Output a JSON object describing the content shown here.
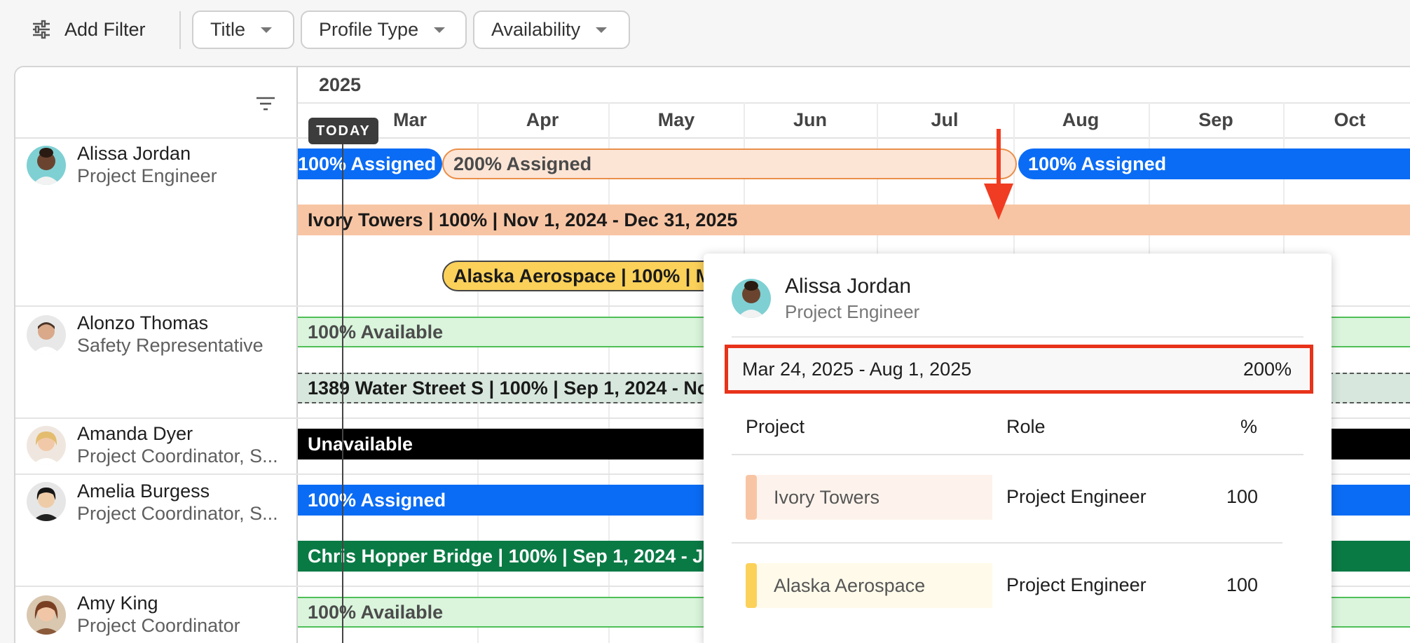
{
  "filters": {
    "add_filter_label": "Add Filter",
    "chips": [
      {
        "label": "Title"
      },
      {
        "label": "Profile Type"
      },
      {
        "label": "Availability"
      }
    ]
  },
  "timeline": {
    "year": "2025",
    "months": [
      "Mar",
      "Apr",
      "May",
      "Jun",
      "Jul",
      "Aug",
      "Sep",
      "Oct"
    ],
    "today_label": "TODAY"
  },
  "people": [
    {
      "name": "Alissa Jordan",
      "title": "Project Engineer"
    },
    {
      "name": "Alonzo Thomas",
      "title": "Safety Representative"
    },
    {
      "name": "Amanda Dyer",
      "title": "Project Coordinator, S..."
    },
    {
      "name": "Amelia Burgess",
      "title": "Project Coordinator, S..."
    },
    {
      "name": "Amy King",
      "title": "Project Coordinator"
    }
  ],
  "bars": {
    "alissa_assigned_1": "100% Assigned",
    "alissa_over": "200% Assigned",
    "alissa_assigned_2": "100% Assigned",
    "alissa_ivory": "Ivory Towers | 100% | Nov 1, 2024 - Dec 31, 2025",
    "alissa_alaska": "Alaska Aerospace | 100% | Mar 24, 2025 - Aug 1, 2025",
    "alonzo_available": "100% Available",
    "alonzo_water": "1389 Water Street S | 100% | Sep 1, 2024 - Nov 30, 2025",
    "amanda_unavailable": "Unavailable",
    "amelia_assigned": "100% Assigned",
    "amelia_bridge": "Chris Hopper Bridge | 100% | Sep 1, 2024 - Jan 31, 2026",
    "amy_available": "100% Available"
  },
  "colors": {
    "assigned": "#0a6cf5",
    "overallocated_fill": "#fde5d6",
    "overallocated_border": "#ea8f4a",
    "ivory_towers": "#f8c5a4",
    "alaska_aerospace": "#fbd15a",
    "available_fill": "#daf5dc",
    "available_border": "#4fbf57",
    "unavailable": "#000000",
    "chris_hopper": "#0a7a45",
    "highlight": "#e8321a"
  },
  "popover": {
    "name": "Alissa Jordan",
    "title": "Project Engineer",
    "date_range": "Mar 24, 2025 - Aug 1, 2025",
    "total_percent": "200%",
    "headers": {
      "project": "Project",
      "role": "Role",
      "percent": "%"
    },
    "rows": [
      {
        "project": "Ivory Towers",
        "role": "Project Engineer",
        "percent": "100"
      },
      {
        "project": "Alaska Aerospace",
        "role": "Project Engineer",
        "percent": "100"
      }
    ]
  }
}
